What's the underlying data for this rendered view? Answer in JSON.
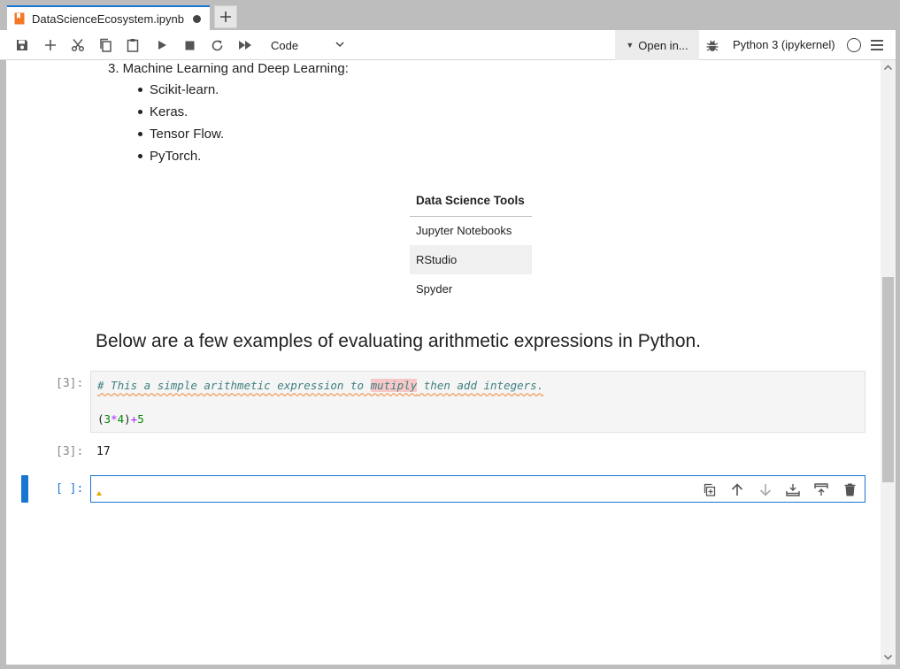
{
  "tab": {
    "title": "DataScienceEcosystem.ipynb",
    "new_tab_label": "+"
  },
  "toolbar": {
    "cell_type": "Code",
    "open_in": "Open in...",
    "kernel_name": "Python 3 (ipykernel)"
  },
  "markdown": {
    "numbered_item": "3. Machine Learning and Deep Learning:",
    "bullets": [
      "Scikit-learn.",
      "Keras.",
      "Tensor Flow.",
      "PyTorch."
    ]
  },
  "tools_table": {
    "header": "Data Science Tools",
    "rows": [
      "Jupyter Notebooks",
      "RStudio",
      "Spyder"
    ]
  },
  "heading": "Below are a few examples of evaluating arithmetic expressions in Python.",
  "code_cell": {
    "prompt": "[3]:",
    "comment_before": "# This a simple arithmetic expression to ",
    "comment_highlight": "mutiply",
    "comment_after": " then add integers.",
    "code_open": "(",
    "code_a": "3",
    "code_op1": "*",
    "code_b": "4",
    "code_close": ")",
    "code_op2": "+",
    "code_c": "5"
  },
  "output_cell": {
    "prompt": "[3]:",
    "value": "17"
  },
  "empty_cell": {
    "prompt": "[ ]:"
  },
  "colors": {
    "accent": "#1976d2",
    "tab_icon": "#f37726"
  }
}
